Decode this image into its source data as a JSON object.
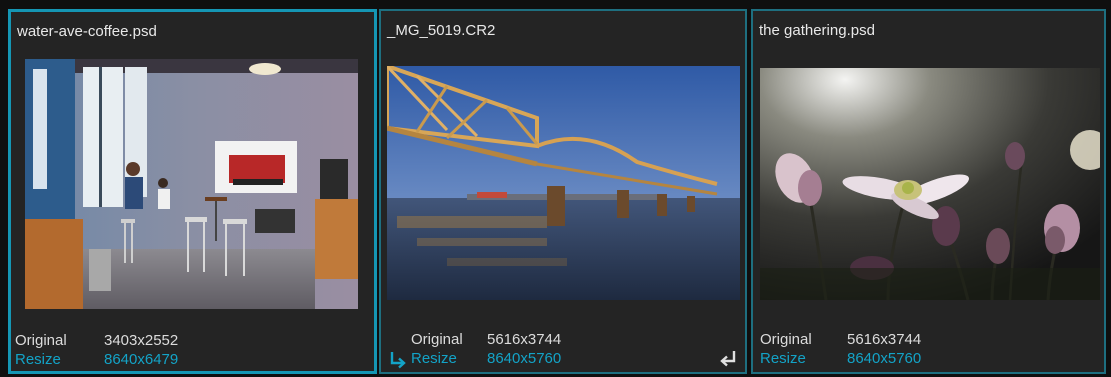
{
  "cards": [
    {
      "filename": "water-ave-coffee.psd",
      "original_label": "Original",
      "original_value": "3403x2552",
      "resize_label": "Resize",
      "resize_value": "8640x6479",
      "selected": true
    },
    {
      "filename": "_MG_5019.CR2",
      "original_label": "Original",
      "original_value": "5616x3744",
      "resize_label": "Resize",
      "resize_value": "8640x5760",
      "selected": false
    },
    {
      "filename": "the gathering.psd",
      "original_label": "Original",
      "original_value": "5616x3744",
      "resize_label": "Resize",
      "resize_value": "8640x5760",
      "selected": false
    }
  ],
  "icons": {
    "card2_resize_prefix": "return-arrow-icon",
    "card2_corner": "enter-arrow-icon"
  },
  "colors": {
    "accent": "#13a3c7",
    "selected_border": "#1596b4",
    "card_bg": "#242424"
  }
}
